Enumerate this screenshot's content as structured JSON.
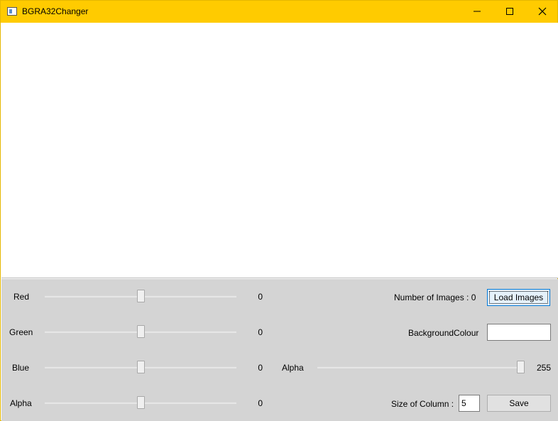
{
  "window": {
    "title": "BGRA32Changer",
    "accent": "#ffcb00"
  },
  "controls": {
    "sliders": [
      {
        "label": "Red",
        "value": "0",
        "level": 0.5
      },
      {
        "label": "Green",
        "value": "0",
        "level": 0.5
      },
      {
        "label": "Blue",
        "value": "0",
        "level": 0.5
      },
      {
        "label": "Alpha",
        "value": "0",
        "level": 0.5
      }
    ],
    "bg_alpha": {
      "label": "Alpha",
      "value": "255",
      "level": 1.0
    },
    "num_images_label": "Number of Images : 0",
    "load_images_label": "Load Images",
    "background_colour_label": "BackgroundColour",
    "background_colour_value": "#ffffff",
    "size_of_column_label": "Size of Column :",
    "size_of_column_value": "5",
    "save_label": "Save"
  }
}
